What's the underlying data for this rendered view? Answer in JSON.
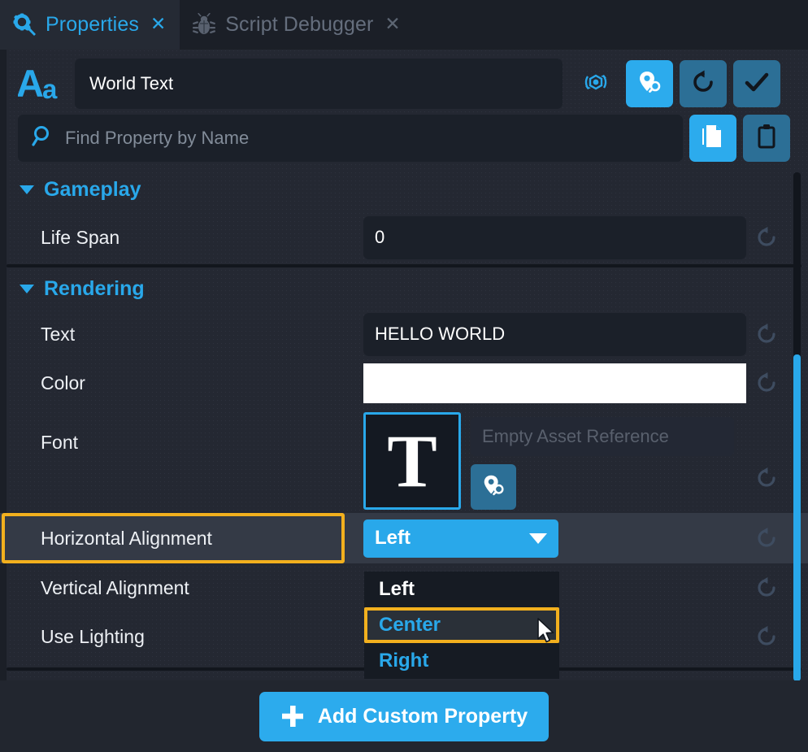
{
  "window": {
    "title": "Properties"
  },
  "tabs": [
    {
      "label": "Properties",
      "icon": "gear-wrench-icon",
      "close": "✕",
      "active": true
    },
    {
      "label": "Script Debugger",
      "icon": "bug-icon",
      "close": "✕",
      "active": false
    }
  ],
  "header": {
    "type_icon": "aa-text-icon",
    "object_name": "World Text",
    "buttons": [
      {
        "name": "orbit-cube-icon",
        "style": "plain"
      },
      {
        "name": "pin-search-icon",
        "style": "bright"
      },
      {
        "name": "reset-icon",
        "style": "dim"
      },
      {
        "name": "checkmark-icon",
        "style": "dim"
      }
    ]
  },
  "search": {
    "placeholder": "Find Property by Name",
    "icon": "search-icon",
    "buttons": [
      {
        "name": "copy-icon",
        "style": "bright"
      },
      {
        "name": "paste-clipboard-icon",
        "style": "dim"
      }
    ]
  },
  "sections": [
    {
      "name": "Gameplay",
      "expanded": true,
      "rows": [
        {
          "label": "Life Span",
          "kind": "text",
          "value": "0",
          "reset": true
        }
      ]
    },
    {
      "name": "Rendering",
      "expanded": true,
      "rows": [
        {
          "label": "Text",
          "kind": "text",
          "value": "HELLO WORLD",
          "reset": true
        },
        {
          "label": "Color",
          "kind": "color",
          "value": "#ffffff",
          "reset": true
        },
        {
          "label": "Font",
          "kind": "asset",
          "thumb": "T",
          "placeholder": "Empty Asset Reference",
          "reset": true
        },
        {
          "label": "Horizontal Alignment",
          "kind": "dropdown",
          "value": "Left",
          "reset": true,
          "highlighted": true
        },
        {
          "label": "Vertical Alignment",
          "kind": "dropdown",
          "value": "",
          "reset": true
        },
        {
          "label": "Use Lighting",
          "kind": "checkbox",
          "value": "",
          "reset": true
        }
      ]
    }
  ],
  "dropdown": {
    "open": true,
    "selected_value": "Left",
    "options": [
      {
        "label": "Left",
        "state": "selected"
      },
      {
        "label": "Center",
        "state": "hover"
      },
      {
        "label": "Right",
        "state": "normal"
      }
    ]
  },
  "footer": {
    "add_label": "Add Custom Property",
    "add_icon": "plus-icon"
  },
  "colors": {
    "accent": "#29a8ea",
    "accent_bright": "#2cabed",
    "accent_dim": "#2c6f96",
    "highlight": "#f2b01e",
    "panel_bg": "#242832",
    "field_bg": "#1b2029",
    "tabbar_bg": "#1b1f27"
  },
  "scrollbar": {
    "name": "vertical-scrollbar",
    "position": "right"
  }
}
